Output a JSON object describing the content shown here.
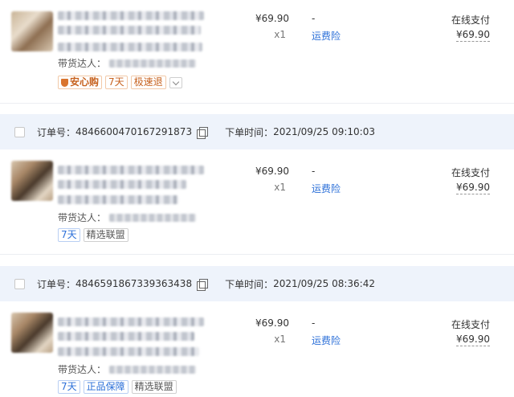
{
  "labels": {
    "order_no_prefix": "订单号：",
    "order_time_prefix": "下单时间：",
    "talent_label": "带货达人：",
    "freight_insurance": "运费险",
    "pay_method": "在线支付",
    "dash": "-"
  },
  "orders": [
    {
      "order_no": "",
      "order_time": "",
      "item": {
        "price": "¥69.90",
        "qty": "x1",
        "paid": "¥69.90",
        "tags": [
          "安心购",
          "7天",
          "极速退"
        ]
      }
    },
    {
      "order_no": "4846600470167291873",
      "order_time": "2021/09/25 09:10:03",
      "item": {
        "price": "¥69.90",
        "qty": "x1",
        "paid": "¥69.90",
        "tags": [
          "7天",
          "精选联盟"
        ]
      }
    },
    {
      "order_no": "4846591867339363438",
      "order_time": "2021/09/25 08:36:42",
      "item": {
        "price": "¥69.90",
        "qty": "x1",
        "paid": "¥69.90",
        "tags": [
          "7天",
          "正品保障",
          "精选联盟"
        ]
      }
    }
  ],
  "colors": {
    "header_bg": "#eef3fb",
    "link_blue": "#2b6fd8",
    "tag_orange": "#c7621f"
  },
  "icons": [
    "copy-icon",
    "shield-icon",
    "chevron-down-icon",
    "checkbox"
  ]
}
